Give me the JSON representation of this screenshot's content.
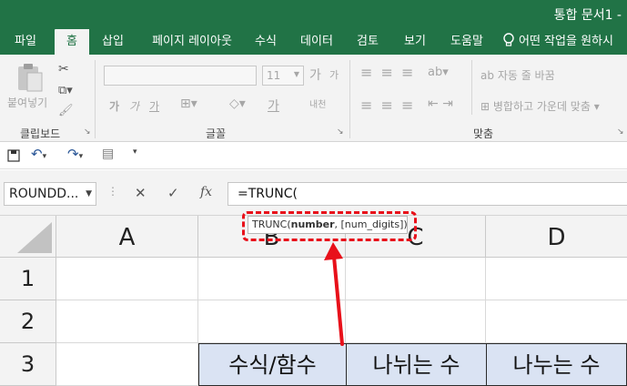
{
  "window": {
    "title": "통합 문서1 -"
  },
  "tabs": [
    "파일",
    "홈",
    "삽입",
    "페이지 레이아웃",
    "수식",
    "데이터",
    "검토",
    "보기",
    "도움말"
  ],
  "tell_me": "어떤 작업을 원하시",
  "ribbon": {
    "clipboard": {
      "paste_label": "붙여넣기",
      "group_label": "클립보드"
    },
    "font": {
      "size": "11",
      "bold": "가",
      "italic": "가",
      "underline": "가",
      "grow": "가",
      "shrink": "가",
      "font_color": "가",
      "phonetic": "내천",
      "group_label": "글꼴"
    },
    "alignment": {
      "wrap_text": "자동 줄 바꿈",
      "merge_center": "병합하고 가운데 맞춤",
      "group_label": "맞춤"
    }
  },
  "formula_bar": {
    "name_box": "ROUNDD...",
    "formula": "=TRUNC(",
    "cancel": "✕",
    "enter": "✓",
    "function": "fx",
    "tooltip_func": "TRUNC(",
    "tooltip_arg1": "number",
    "tooltip_sep": ", ",
    "tooltip_arg2": "[num_digits]",
    "tooltip_close": ")"
  },
  "grid": {
    "columns": [
      "A",
      "B",
      "C",
      "D"
    ],
    "rows": [
      "1",
      "2",
      "3"
    ],
    "row3": [
      "수식/함수",
      "나뉘는 수",
      "나누는 수"
    ]
  },
  "colors": {
    "excel_green": "#217346",
    "annotation_red": "#e8101a",
    "header_fill": "#dae3f3"
  }
}
